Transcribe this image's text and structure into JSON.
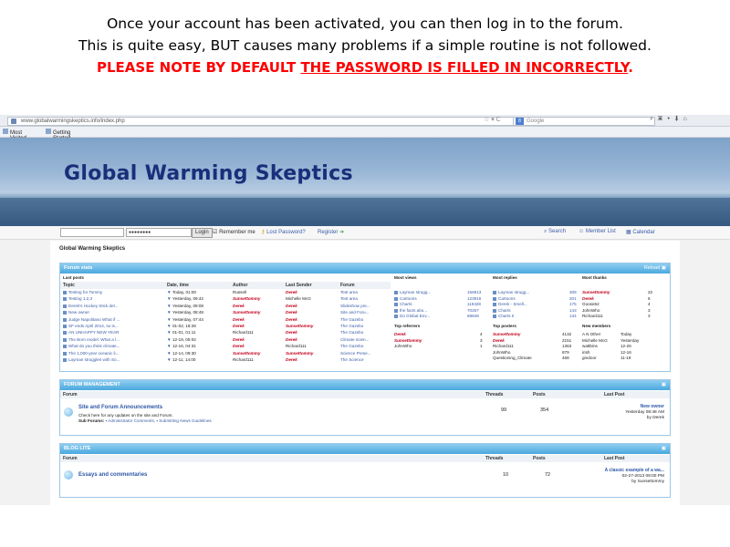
{
  "caption": {
    "line1": "Once your account has been activated, you can then log in to the forum.",
    "line2": "This is quite easy, BUT causes many problems if a simple routine is not followed.",
    "warn_prefix": "PLEASE NOTE BY DEFAULT ",
    "warn_underlined": "THE PASSWORD IS FILLED IN INCORRECTLY",
    "warn_suffix": "."
  },
  "browser": {
    "url": "www.globalwarmingskeptics.info/index.php",
    "search_placeholder": "Google",
    "bookmarks": [
      "Most Visited",
      "Getting Started"
    ]
  },
  "banner": {
    "title": "Global Warming Skeptics"
  },
  "login": {
    "password_value": "●●●●●●●●",
    "login_label": "Login",
    "remember_label": "Remember me",
    "lost_password": "Lost Password?",
    "register": "Register",
    "search": "Search",
    "member_list": "Member List",
    "calendar": "Calendar"
  },
  "site_name": "Global Warming Skeptics",
  "stats": {
    "header": "Forum stats",
    "reload": "Reload",
    "last_posts_title": "Last posts",
    "columns": [
      "Topic",
      "Date, time",
      "Author",
      "Last Sender",
      "Forum"
    ],
    "posts": [
      {
        "topic": "Testing for Tommy",
        "date": "Today, 01:00",
        "author": "Russell",
        "sender": "Derek",
        "forum": "Test area"
      },
      {
        "topic": "Testing 1,2,3",
        "date": "Yesterday, 09:42",
        "author": "Sunsettommy",
        "sender": "Michelle McG",
        "forum": "Test area"
      },
      {
        "topic": "Derek's Hockey Stick del...",
        "date": "Yesterday, 09:08",
        "author": "Derek",
        "sender": "Derek",
        "forum": "Slideshow pre..."
      },
      {
        "topic": "New owner",
        "date": "Yesterday, 08:48",
        "author": "Sunsettommy",
        "sender": "Derek",
        "forum": "Site and Foru..."
      },
      {
        "topic": "Judge Napolitano What if ...",
        "date": "Yesterday, 07:44",
        "author": "Derek",
        "sender": "Derek",
        "forum": "The Gazebo"
      },
      {
        "topic": "SF ends April 2014, so is...",
        "date": "01-02, 18:28",
        "author": "Derek",
        "sender": "Sunsettommy",
        "forum": "The Gazebo"
      },
      {
        "topic": "AN UNHAPPY NEW YEAR",
        "date": "01-01, 01:11",
        "author": "Richard111",
        "sender": "Derek",
        "forum": "The Gazebo"
      },
      {
        "topic": "The Born model. What a l...",
        "date": "12-19, 05:02",
        "author": "Derek",
        "sender": "Derek",
        "forum": "Climate scien..."
      },
      {
        "topic": "What do you think climate...",
        "date": "12-16, 04:31",
        "author": "Derek",
        "sender": "Richard111",
        "forum": "The Gazebo"
      },
      {
        "topic": "The 1,000-year oceanic li...",
        "date": "12-14, 09:30",
        "author": "Sunsettommy",
        "sender": "Sunsettommy",
        "forum": "Science Prese..."
      },
      {
        "topic": "Layman struggles with So...",
        "date": "12-11, 14:00",
        "author": "Richard111",
        "sender": "Derek",
        "forum": "The Science"
      }
    ],
    "most_views_title": "Most views",
    "most_views": [
      {
        "name": "Layman strugg...",
        "v": "156813"
      },
      {
        "name": "Cartoons",
        "v": "123916"
      },
      {
        "name": "Charts",
        "v": "119428"
      },
      {
        "name": "the facts abo...",
        "v": "70267"
      },
      {
        "name": "Do Global Env...",
        "v": "69848"
      }
    ],
    "most_replies_title": "Most replies",
    "most_replies": [
      {
        "name": "Layman strugg...",
        "v": "308"
      },
      {
        "name": "Cartoons",
        "v": "201"
      },
      {
        "name": "Derek - Smell...",
        "v": "175"
      },
      {
        "name": "Charts",
        "v": "143"
      },
      {
        "name": "Charts II",
        "v": "134"
      }
    ],
    "most_thanks_title": "Most thanks",
    "most_thanks": [
      {
        "name": "Sunsettommy",
        "v": "22"
      },
      {
        "name": "Derek",
        "v": "6"
      },
      {
        "name": "Goose52",
        "v": "4"
      },
      {
        "name": "JohnWho",
        "v": "3"
      },
      {
        "name": "Richard111",
        "v": "3"
      }
    ],
    "top_referrers_title": "Top referrers",
    "top_referrers": [
      {
        "name": "Derek",
        "v": "4"
      },
      {
        "name": "Sunsettommy",
        "v": "3"
      },
      {
        "name": "JohnWho",
        "v": "1"
      }
    ],
    "top_posters_title": "Top posters",
    "top_posters": [
      {
        "name": "Sunsettommy",
        "v": "4132"
      },
      {
        "name": "Derek",
        "v": "2151"
      },
      {
        "name": "Richard111",
        "v": "1363"
      },
      {
        "name": "JohnWho",
        "v": "879"
      },
      {
        "name": "Questioning_Climate",
        "v": "468"
      }
    ],
    "new_members_title": "New members",
    "new_members": [
      {
        "name": "A N Other",
        "v": "Today"
      },
      {
        "name": "Michelle McG",
        "v": "Yesterday"
      },
      {
        "name": "wattbins",
        "v": "12-26"
      },
      {
        "name": "irish",
        "v": "12-16"
      },
      {
        "name": "gmdoor",
        "v": "11-19"
      }
    ]
  },
  "forum_mgmt": {
    "header": "FORUM MANAGEMENT",
    "col_forum": "Forum",
    "col_threads": "Threads",
    "col_posts": "Posts",
    "col_last": "Last Post",
    "title": "Site and Forum Announcements",
    "desc": "Check here for any updates on the site and Forum.",
    "sub_label": "Sub Forums:",
    "sub1": "Administrator Comments,",
    "sub2": "Submitting News Guidelines",
    "threads": "99",
    "posts": "354",
    "last_title": "New owner",
    "last_date": "Yesterday 08:48 AM",
    "last_by": "by Derek"
  },
  "blog": {
    "header": "BLOG LITE",
    "col_forum": "Forum",
    "col_threads": "Threads",
    "col_posts": "Posts",
    "col_last": "Last Post",
    "title": "Essays and commentaries",
    "threads": "10",
    "posts": "72",
    "last_title": "A classic example of a wa...",
    "last_date": "02-27-2013 09:00 PM",
    "last_by": "by Sunsettommy"
  }
}
